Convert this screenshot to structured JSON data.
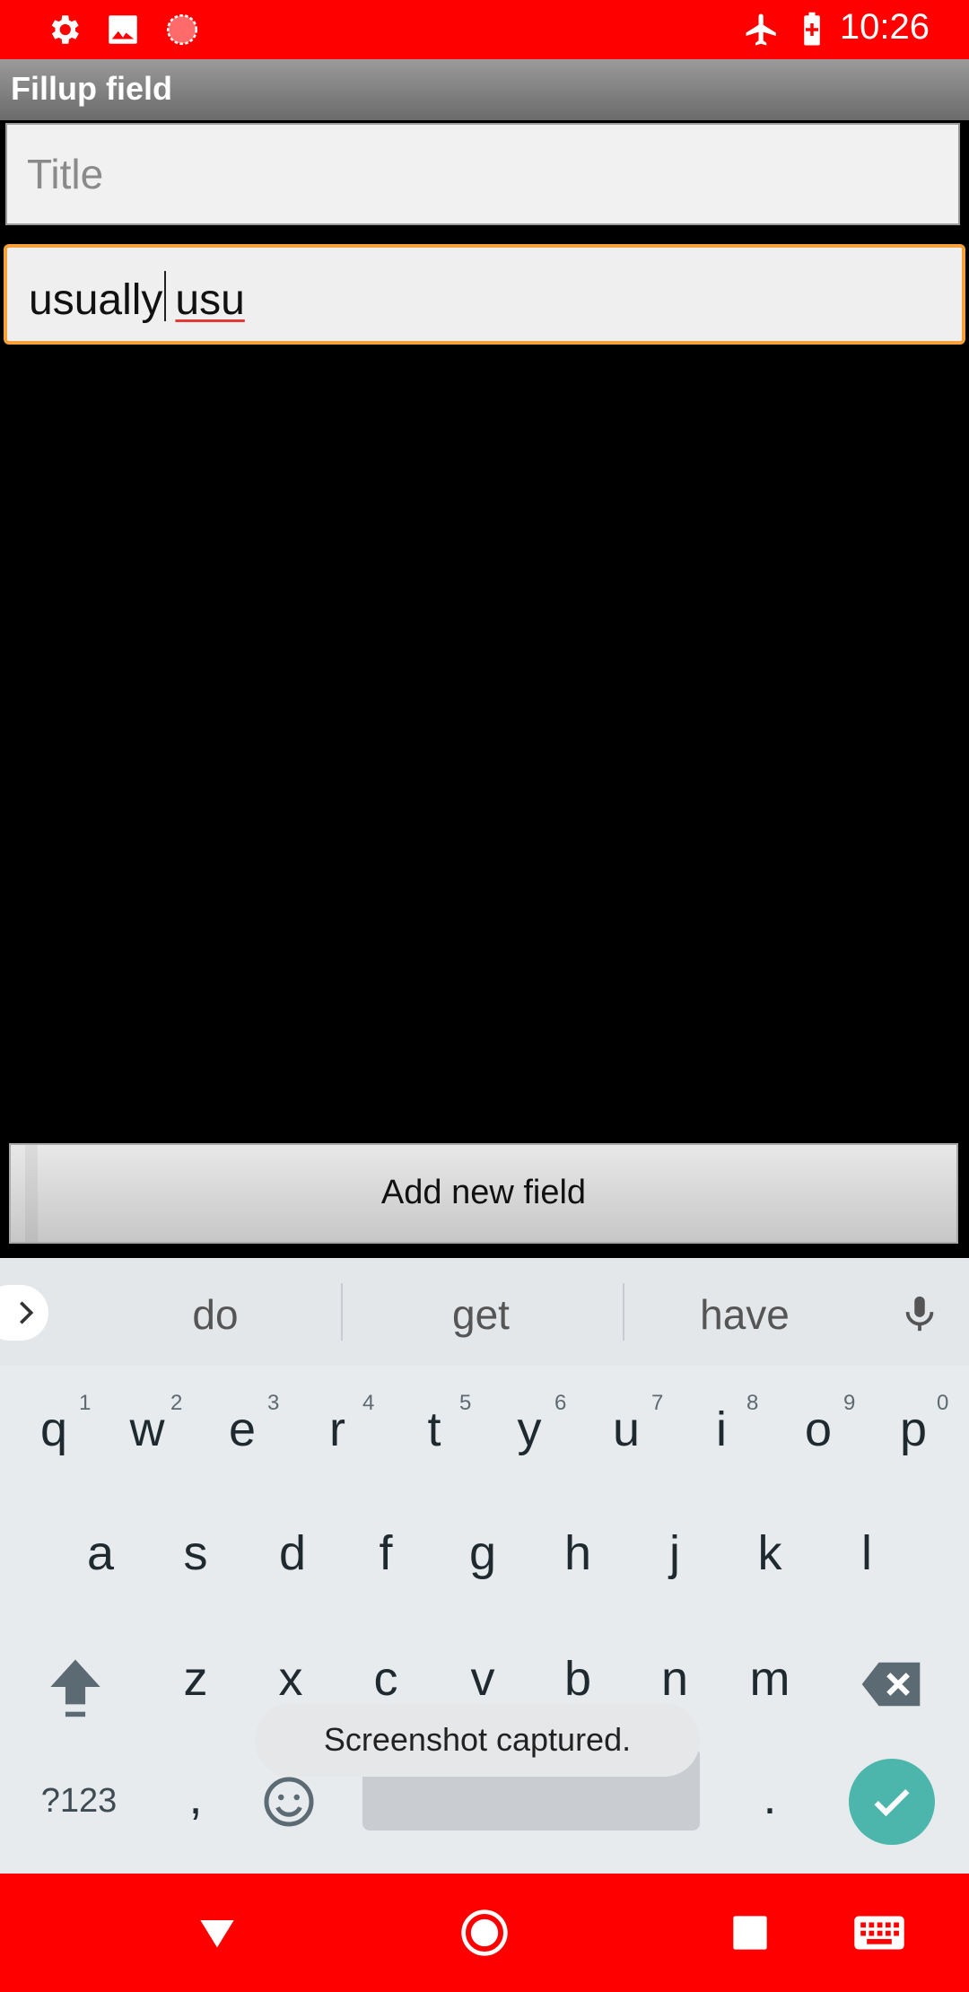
{
  "status_bar": {
    "time": "10:26",
    "left_icons": [
      "settings-icon",
      "image-icon",
      "record-icon"
    ],
    "right_icons": [
      "airplane-mode-icon",
      "battery-charging-icon"
    ],
    "color": "#ff0000"
  },
  "app_bar": {
    "title": "Fillup field"
  },
  "form": {
    "title_placeholder": "Title",
    "text_before_cursor": "usually",
    "text_after_cursor": "usu",
    "add_button_label": "Add new field"
  },
  "keyboard": {
    "suggestions": [
      "do",
      "get",
      "have"
    ],
    "row1": [
      {
        "key": "q",
        "hint": "1"
      },
      {
        "key": "w",
        "hint": "2"
      },
      {
        "key": "e",
        "hint": "3"
      },
      {
        "key": "r",
        "hint": "4"
      },
      {
        "key": "t",
        "hint": "5"
      },
      {
        "key": "y",
        "hint": "6"
      },
      {
        "key": "u",
        "hint": "7"
      },
      {
        "key": "i",
        "hint": "8"
      },
      {
        "key": "o",
        "hint": "9"
      },
      {
        "key": "p",
        "hint": "0"
      }
    ],
    "row2": [
      "a",
      "s",
      "d",
      "f",
      "g",
      "h",
      "j",
      "k",
      "l"
    ],
    "row3": [
      "z",
      "x",
      "c",
      "v",
      "b",
      "n",
      "m"
    ],
    "symbols_label": "?123",
    "comma": ",",
    "period": ".",
    "accent_color": "#4db6ac"
  },
  "toast": {
    "message": "Screenshot captured."
  },
  "nav_bar": {
    "color": "#ff0000",
    "icons": [
      "back-icon",
      "home-icon",
      "recents-icon",
      "keyboard-switch-icon"
    ]
  }
}
